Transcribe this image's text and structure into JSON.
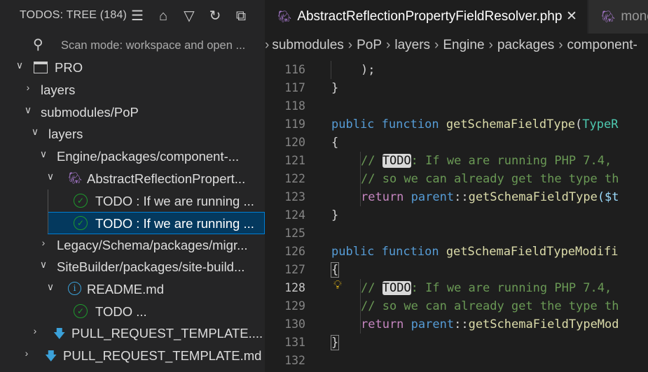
{
  "sidebar": {
    "title": "TODOS: TREE (184)",
    "scan_mode": "Scan mode: workspace and open ...",
    "rows": [
      {
        "label": "PRO"
      },
      {
        "label": "layers"
      },
      {
        "label": "submodules/PoP"
      },
      {
        "label": "layers"
      },
      {
        "label": "Engine/packages/component-..."
      },
      {
        "label": "AbstractReflectionPropert..."
      },
      {
        "label": "TODO : If we are running ..."
      },
      {
        "label": "TODO : If we are running ..."
      },
      {
        "label": "Legacy/Schema/packages/migr..."
      },
      {
        "label": "SiteBuilder/packages/site-build..."
      },
      {
        "label": "README.md"
      },
      {
        "label": "TODO ..."
      },
      {
        "label": "PULL_REQUEST_TEMPLATE...."
      },
      {
        "label": "PULL_REQUEST_TEMPLATE.md"
      }
    ]
  },
  "editor": {
    "tabs": [
      {
        "label": "AbstractReflectionPropertyFieldResolver.php",
        "active": true
      },
      {
        "label": "mone",
        "active": false
      }
    ],
    "breadcrumb": [
      "submodules",
      "PoP",
      "layers",
      "Engine",
      "packages",
      "component-"
    ],
    "line_numbers": [
      "116",
      "117",
      "118",
      "119",
      "120",
      "121",
      "122",
      "123",
      "124",
      "125",
      "126",
      "127",
      "128",
      "129",
      "130",
      "131",
      "132"
    ],
    "current_line": "128",
    "code": {
      "l116": ");",
      "l117": "}",
      "public": "public",
      "function": "function",
      "fn1": "getSchemaFieldType",
      "type1": "TypeR",
      "brace_open": "{",
      "brace_close": "}",
      "comment_prefix": "// ",
      "todo": "TODO",
      "comment1_rest": ": If we are running PHP 7.4,",
      "comment2": "// so we can already get the type th",
      "return": "return",
      "parent": "parent",
      "dcolon": "::",
      "ret1_fn": "getSchemaFieldType",
      "ret1_arg": "($t",
      "fn2": "getSchemaFieldTypeModifi",
      "ret2_fn": "getSchemaFieldTypeMod"
    }
  },
  "colors": {
    "selection": "#04395e",
    "keyword": "#569cd6",
    "comment": "#6a9955",
    "function": "#dcdcaa"
  }
}
